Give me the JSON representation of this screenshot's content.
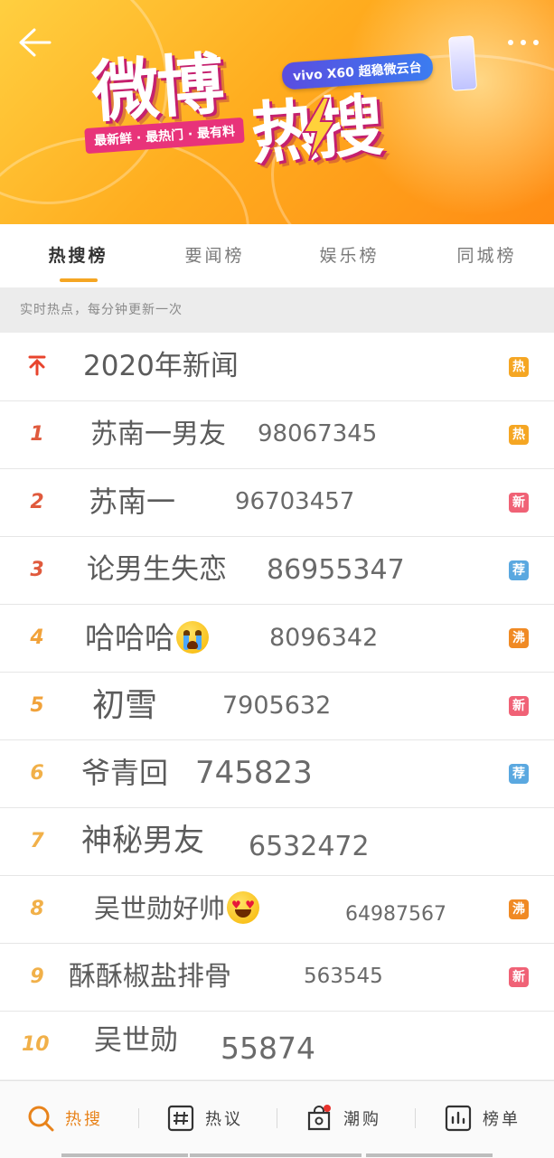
{
  "banner": {
    "title_line1": "微博",
    "title_line2": "热搜",
    "slogan": "最新鲜 · 最热门 · 最有料",
    "sponsor": "vivo X60 超稳微云台"
  },
  "tabs": [
    {
      "label": "热搜榜",
      "active": true
    },
    {
      "label": "要闻榜",
      "active": false
    },
    {
      "label": "娱乐榜",
      "active": false
    },
    {
      "label": "同城榜",
      "active": false
    }
  ],
  "subtitle": "实时热点，每分钟更新一次",
  "list": [
    {
      "rank": "",
      "pinned": true,
      "title": "2020年新闻",
      "count": "",
      "tag": "热",
      "tag_color": "#f5a623",
      "emoji": ""
    },
    {
      "rank": "1",
      "title": "苏南一男友",
      "count": "98067345",
      "tag": "热",
      "tag_color": "#f5a623",
      "emoji": ""
    },
    {
      "rank": "2",
      "title": "苏南一",
      "count": "96703457",
      "tag": "新",
      "tag_color": "#f06276",
      "emoji": ""
    },
    {
      "rank": "3",
      "title": "论男生失恋",
      "count": "86955347",
      "tag": "荐",
      "tag_color": "#5aa8e0",
      "emoji": ""
    },
    {
      "rank": "4",
      "title": "哈哈哈",
      "count": "8096342",
      "tag": "沸",
      "tag_color": "#f08a24",
      "emoji": "crying-face"
    },
    {
      "rank": "5",
      "title": "初雪",
      "count": "7905632",
      "tag": "新",
      "tag_color": "#f06276",
      "emoji": ""
    },
    {
      "rank": "6",
      "title": "爷青回",
      "count": "745823",
      "tag": "荐",
      "tag_color": "#5aa8e0",
      "emoji": ""
    },
    {
      "rank": "7",
      "title": "神秘男友",
      "count": "6532472",
      "tag": "",
      "tag_color": "",
      "emoji": ""
    },
    {
      "rank": "8",
      "title": "吴世勋好帅",
      "count": "64987567",
      "tag": "沸",
      "tag_color": "#f08a24",
      "emoji": "heart-eyes-face"
    },
    {
      "rank": "9",
      "title": "酥酥椒盐排骨",
      "count": "563545",
      "tag": "新",
      "tag_color": "#f06276",
      "emoji": ""
    },
    {
      "rank": "10",
      "title": "吴世勋",
      "count": "55874",
      "tag": "",
      "tag_color": "",
      "emoji": ""
    }
  ],
  "bottom_nav": [
    {
      "label": "热搜",
      "icon": "search-icon",
      "active": true
    },
    {
      "label": "热议",
      "icon": "hashtag-icon",
      "active": false
    },
    {
      "label": "潮购",
      "icon": "bag-icon",
      "active": false
    },
    {
      "label": "榜单",
      "icon": "chart-icon",
      "active": false
    }
  ],
  "colors": {
    "accent": "#f5a623",
    "banner_start": "#ffcf40",
    "banner_end": "#ff8c14",
    "logo_shadow": "#c5206e"
  }
}
